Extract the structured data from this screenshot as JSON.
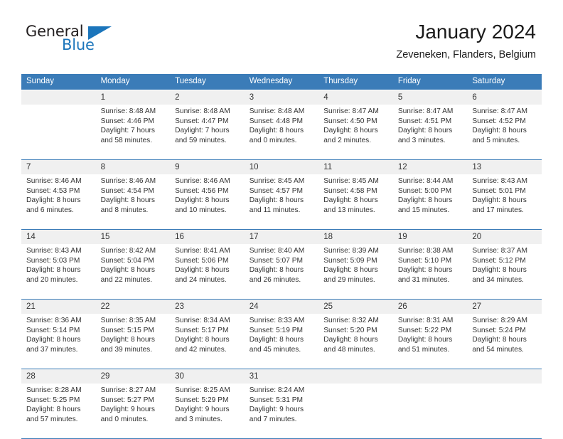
{
  "brand": {
    "name_top": "General",
    "name_bottom": "Blue",
    "accent_color": "#1b75bb",
    "text_color": "#231f20"
  },
  "header": {
    "title": "January 2024",
    "subtitle": "Zeveneken, Flanders, Belgium"
  },
  "theme": {
    "header_blue": "#3b7cb8",
    "daynum_bg": "#f0f0f0",
    "cell_bg": "#ffffff",
    "text": "#333333"
  },
  "weekday_headers": [
    "Sunday",
    "Monday",
    "Tuesday",
    "Wednesday",
    "Thursday",
    "Friday",
    "Saturday"
  ],
  "weeks": [
    {
      "days": [
        {
          "date": "",
          "sunrise": "",
          "sunset": "",
          "daylight_1": "",
          "daylight_2": ""
        },
        {
          "date": "1",
          "sunrise": "Sunrise: 8:48 AM",
          "sunset": "Sunset: 4:46 PM",
          "daylight_1": "Daylight: 7 hours",
          "daylight_2": "and 58 minutes."
        },
        {
          "date": "2",
          "sunrise": "Sunrise: 8:48 AM",
          "sunset": "Sunset: 4:47 PM",
          "daylight_1": "Daylight: 7 hours",
          "daylight_2": "and 59 minutes."
        },
        {
          "date": "3",
          "sunrise": "Sunrise: 8:48 AM",
          "sunset": "Sunset: 4:48 PM",
          "daylight_1": "Daylight: 8 hours",
          "daylight_2": "and 0 minutes."
        },
        {
          "date": "4",
          "sunrise": "Sunrise: 8:47 AM",
          "sunset": "Sunset: 4:50 PM",
          "daylight_1": "Daylight: 8 hours",
          "daylight_2": "and 2 minutes."
        },
        {
          "date": "5",
          "sunrise": "Sunrise: 8:47 AM",
          "sunset": "Sunset: 4:51 PM",
          "daylight_1": "Daylight: 8 hours",
          "daylight_2": "and 3 minutes."
        },
        {
          "date": "6",
          "sunrise": "Sunrise: 8:47 AM",
          "sunset": "Sunset: 4:52 PM",
          "daylight_1": "Daylight: 8 hours",
          "daylight_2": "and 5 minutes."
        }
      ]
    },
    {
      "days": [
        {
          "date": "7",
          "sunrise": "Sunrise: 8:46 AM",
          "sunset": "Sunset: 4:53 PM",
          "daylight_1": "Daylight: 8 hours",
          "daylight_2": "and 6 minutes."
        },
        {
          "date": "8",
          "sunrise": "Sunrise: 8:46 AM",
          "sunset": "Sunset: 4:54 PM",
          "daylight_1": "Daylight: 8 hours",
          "daylight_2": "and 8 minutes."
        },
        {
          "date": "9",
          "sunrise": "Sunrise: 8:46 AM",
          "sunset": "Sunset: 4:56 PM",
          "daylight_1": "Daylight: 8 hours",
          "daylight_2": "and 10 minutes."
        },
        {
          "date": "10",
          "sunrise": "Sunrise: 8:45 AM",
          "sunset": "Sunset: 4:57 PM",
          "daylight_1": "Daylight: 8 hours",
          "daylight_2": "and 11 minutes."
        },
        {
          "date": "11",
          "sunrise": "Sunrise: 8:45 AM",
          "sunset": "Sunset: 4:58 PM",
          "daylight_1": "Daylight: 8 hours",
          "daylight_2": "and 13 minutes."
        },
        {
          "date": "12",
          "sunrise": "Sunrise: 8:44 AM",
          "sunset": "Sunset: 5:00 PM",
          "daylight_1": "Daylight: 8 hours",
          "daylight_2": "and 15 minutes."
        },
        {
          "date": "13",
          "sunrise": "Sunrise: 8:43 AM",
          "sunset": "Sunset: 5:01 PM",
          "daylight_1": "Daylight: 8 hours",
          "daylight_2": "and 17 minutes."
        }
      ]
    },
    {
      "days": [
        {
          "date": "14",
          "sunrise": "Sunrise: 8:43 AM",
          "sunset": "Sunset: 5:03 PM",
          "daylight_1": "Daylight: 8 hours",
          "daylight_2": "and 20 minutes."
        },
        {
          "date": "15",
          "sunrise": "Sunrise: 8:42 AM",
          "sunset": "Sunset: 5:04 PM",
          "daylight_1": "Daylight: 8 hours",
          "daylight_2": "and 22 minutes."
        },
        {
          "date": "16",
          "sunrise": "Sunrise: 8:41 AM",
          "sunset": "Sunset: 5:06 PM",
          "daylight_1": "Daylight: 8 hours",
          "daylight_2": "and 24 minutes."
        },
        {
          "date": "17",
          "sunrise": "Sunrise: 8:40 AM",
          "sunset": "Sunset: 5:07 PM",
          "daylight_1": "Daylight: 8 hours",
          "daylight_2": "and 26 minutes."
        },
        {
          "date": "18",
          "sunrise": "Sunrise: 8:39 AM",
          "sunset": "Sunset: 5:09 PM",
          "daylight_1": "Daylight: 8 hours",
          "daylight_2": "and 29 minutes."
        },
        {
          "date": "19",
          "sunrise": "Sunrise: 8:38 AM",
          "sunset": "Sunset: 5:10 PM",
          "daylight_1": "Daylight: 8 hours",
          "daylight_2": "and 31 minutes."
        },
        {
          "date": "20",
          "sunrise": "Sunrise: 8:37 AM",
          "sunset": "Sunset: 5:12 PM",
          "daylight_1": "Daylight: 8 hours",
          "daylight_2": "and 34 minutes."
        }
      ]
    },
    {
      "days": [
        {
          "date": "21",
          "sunrise": "Sunrise: 8:36 AM",
          "sunset": "Sunset: 5:14 PM",
          "daylight_1": "Daylight: 8 hours",
          "daylight_2": "and 37 minutes."
        },
        {
          "date": "22",
          "sunrise": "Sunrise: 8:35 AM",
          "sunset": "Sunset: 5:15 PM",
          "daylight_1": "Daylight: 8 hours",
          "daylight_2": "and 39 minutes."
        },
        {
          "date": "23",
          "sunrise": "Sunrise: 8:34 AM",
          "sunset": "Sunset: 5:17 PM",
          "daylight_1": "Daylight: 8 hours",
          "daylight_2": "and 42 minutes."
        },
        {
          "date": "24",
          "sunrise": "Sunrise: 8:33 AM",
          "sunset": "Sunset: 5:19 PM",
          "daylight_1": "Daylight: 8 hours",
          "daylight_2": "and 45 minutes."
        },
        {
          "date": "25",
          "sunrise": "Sunrise: 8:32 AM",
          "sunset": "Sunset: 5:20 PM",
          "daylight_1": "Daylight: 8 hours",
          "daylight_2": "and 48 minutes."
        },
        {
          "date": "26",
          "sunrise": "Sunrise: 8:31 AM",
          "sunset": "Sunset: 5:22 PM",
          "daylight_1": "Daylight: 8 hours",
          "daylight_2": "and 51 minutes."
        },
        {
          "date": "27",
          "sunrise": "Sunrise: 8:29 AM",
          "sunset": "Sunset: 5:24 PM",
          "daylight_1": "Daylight: 8 hours",
          "daylight_2": "and 54 minutes."
        }
      ]
    },
    {
      "days": [
        {
          "date": "28",
          "sunrise": "Sunrise: 8:28 AM",
          "sunset": "Sunset: 5:25 PM",
          "daylight_1": "Daylight: 8 hours",
          "daylight_2": "and 57 minutes."
        },
        {
          "date": "29",
          "sunrise": "Sunrise: 8:27 AM",
          "sunset": "Sunset: 5:27 PM",
          "daylight_1": "Daylight: 9 hours",
          "daylight_2": "and 0 minutes."
        },
        {
          "date": "30",
          "sunrise": "Sunrise: 8:25 AM",
          "sunset": "Sunset: 5:29 PM",
          "daylight_1": "Daylight: 9 hours",
          "daylight_2": "and 3 minutes."
        },
        {
          "date": "31",
          "sunrise": "Sunrise: 8:24 AM",
          "sunset": "Sunset: 5:31 PM",
          "daylight_1": "Daylight: 9 hours",
          "daylight_2": "and 7 minutes."
        },
        {
          "date": "",
          "sunrise": "",
          "sunset": "",
          "daylight_1": "",
          "daylight_2": ""
        },
        {
          "date": "",
          "sunrise": "",
          "sunset": "",
          "daylight_1": "",
          "daylight_2": ""
        },
        {
          "date": "",
          "sunrise": "",
          "sunset": "",
          "daylight_1": "",
          "daylight_2": ""
        }
      ]
    }
  ]
}
